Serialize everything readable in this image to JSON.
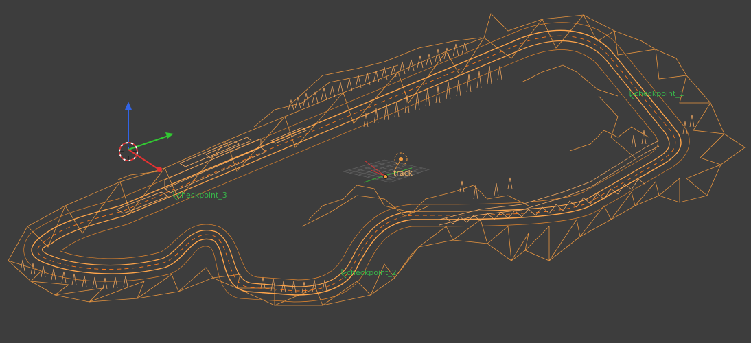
{
  "viewport": {
    "background": "#3d3d3d",
    "wire_color": "#ffa54a",
    "wire_color_dim": "#e28a35"
  },
  "objects": {
    "track_label": "track",
    "checkpoint_1_label": "checkpoint_1",
    "checkpoint_2_label": "checkpoint_2",
    "checkpoint_3_label": "checkpoint_3"
  },
  "gizmo": {
    "x_axis_color": "#e63232",
    "y_axis_color": "#32c832",
    "z_axis_color": "#3264e6",
    "icon": "3d-cursor-icon"
  }
}
